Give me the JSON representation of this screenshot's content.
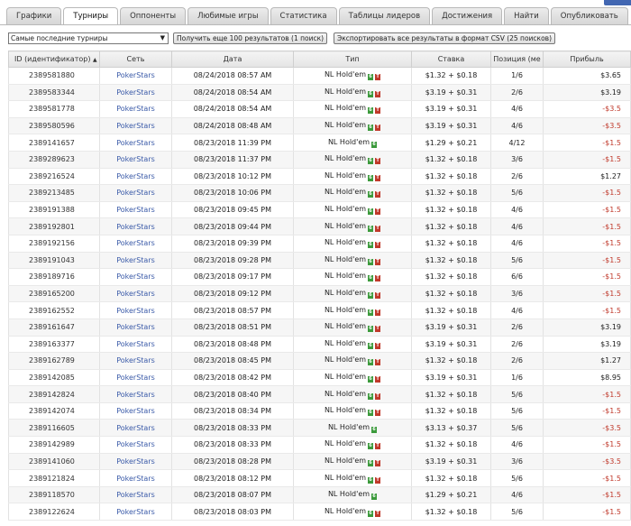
{
  "tabs": [
    {
      "label": "Графики",
      "active": false
    },
    {
      "label": "Турниры",
      "active": true
    },
    {
      "label": "Оппоненты",
      "active": false
    },
    {
      "label": "Любимые игры",
      "active": false
    },
    {
      "label": "Статистика",
      "active": false
    },
    {
      "label": "Таблицы лидеров",
      "active": false
    },
    {
      "label": "Достижения",
      "active": false
    },
    {
      "label": "Найти",
      "active": false
    },
    {
      "label": "Опубликовать",
      "active": false
    }
  ],
  "controls": {
    "filter_value": "Самые последние турниры",
    "more_button": "Получить еще 100 результатов (1 поиск)",
    "export_button": "Экспортировать все результаты в формат CSV (25 поисков)"
  },
  "table": {
    "headers": {
      "id": "ID (идентификатор)",
      "site": "Сеть",
      "date": "Дата",
      "type": "Тип",
      "stake": "Ставка",
      "position": "Позиция (ме",
      "profit": "Прибыль"
    },
    "rows": [
      {
        "id": "2389581880",
        "site": "PokerStars",
        "date": "08/24/2018 08:57 AM",
        "type": "NL Hold'em",
        "badge2": true,
        "stake": "$1.32 + $0.18",
        "position": "1/6",
        "profit": "$3.65",
        "neg": false
      },
      {
        "id": "2389583344",
        "site": "PokerStars",
        "date": "08/24/2018 08:54 AM",
        "type": "NL Hold'em",
        "badge2": true,
        "stake": "$3.19 + $0.31",
        "position": "2/6",
        "profit": "$3.19",
        "neg": false
      },
      {
        "id": "2389581778",
        "site": "PokerStars",
        "date": "08/24/2018 08:54 AM",
        "type": "NL Hold'em",
        "badge2": true,
        "stake": "$3.19 + $0.31",
        "position": "4/6",
        "profit": "-$3.5",
        "neg": true
      },
      {
        "id": "2389580596",
        "site": "PokerStars",
        "date": "08/24/2018 08:48 AM",
        "type": "NL Hold'em",
        "badge2": true,
        "stake": "$3.19 + $0.31",
        "position": "4/6",
        "profit": "-$3.5",
        "neg": true
      },
      {
        "id": "2389141657",
        "site": "PokerStars",
        "date": "08/23/2018 11:39 PM",
        "type": "NL Hold'em",
        "badge2": false,
        "stake": "$1.29 + $0.21",
        "position": "4/12",
        "profit": "-$1.5",
        "neg": true
      },
      {
        "id": "2389289623",
        "site": "PokerStars",
        "date": "08/23/2018 11:37 PM",
        "type": "NL Hold'em",
        "badge2": true,
        "stake": "$1.32 + $0.18",
        "position": "3/6",
        "profit": "-$1.5",
        "neg": true
      },
      {
        "id": "2389216524",
        "site": "PokerStars",
        "date": "08/23/2018 10:12 PM",
        "type": "NL Hold'em",
        "badge2": true,
        "stake": "$1.32 + $0.18",
        "position": "2/6",
        "profit": "$1.27",
        "neg": false
      },
      {
        "id": "2389213485",
        "site": "PokerStars",
        "date": "08/23/2018 10:06 PM",
        "type": "NL Hold'em",
        "badge2": true,
        "stake": "$1.32 + $0.18",
        "position": "5/6",
        "profit": "-$1.5",
        "neg": true
      },
      {
        "id": "2389191388",
        "site": "PokerStars",
        "date": "08/23/2018 09:45 PM",
        "type": "NL Hold'em",
        "badge2": true,
        "stake": "$1.32 + $0.18",
        "position": "4/6",
        "profit": "-$1.5",
        "neg": true
      },
      {
        "id": "2389192801",
        "site": "PokerStars",
        "date": "08/23/2018 09:44 PM",
        "type": "NL Hold'em",
        "badge2": true,
        "stake": "$1.32 + $0.18",
        "position": "4/6",
        "profit": "-$1.5",
        "neg": true
      },
      {
        "id": "2389192156",
        "site": "PokerStars",
        "date": "08/23/2018 09:39 PM",
        "type": "NL Hold'em",
        "badge2": true,
        "stake": "$1.32 + $0.18",
        "position": "4/6",
        "profit": "-$1.5",
        "neg": true
      },
      {
        "id": "2389191043",
        "site": "PokerStars",
        "date": "08/23/2018 09:28 PM",
        "type": "NL Hold'em",
        "badge2": true,
        "stake": "$1.32 + $0.18",
        "position": "5/6",
        "profit": "-$1.5",
        "neg": true
      },
      {
        "id": "2389189716",
        "site": "PokerStars",
        "date": "08/23/2018 09:17 PM",
        "type": "NL Hold'em",
        "badge2": true,
        "stake": "$1.32 + $0.18",
        "position": "6/6",
        "profit": "-$1.5",
        "neg": true
      },
      {
        "id": "2389165200",
        "site": "PokerStars",
        "date": "08/23/2018 09:12 PM",
        "type": "NL Hold'em",
        "badge2": true,
        "stake": "$1.32 + $0.18",
        "position": "3/6",
        "profit": "-$1.5",
        "neg": true
      },
      {
        "id": "2389162552",
        "site": "PokerStars",
        "date": "08/23/2018 08:57 PM",
        "type": "NL Hold'em",
        "badge2": true,
        "stake": "$1.32 + $0.18",
        "position": "4/6",
        "profit": "-$1.5",
        "neg": true
      },
      {
        "id": "2389161647",
        "site": "PokerStars",
        "date": "08/23/2018 08:51 PM",
        "type": "NL Hold'em",
        "badge2": true,
        "stake": "$3.19 + $0.31",
        "position": "2/6",
        "profit": "$3.19",
        "neg": false
      },
      {
        "id": "2389163377",
        "site": "PokerStars",
        "date": "08/23/2018 08:48 PM",
        "type": "NL Hold'em",
        "badge2": true,
        "stake": "$3.19 + $0.31",
        "position": "2/6",
        "profit": "$3.19",
        "neg": false
      },
      {
        "id": "2389162789",
        "site": "PokerStars",
        "date": "08/23/2018 08:45 PM",
        "type": "NL Hold'em",
        "badge2": true,
        "stake": "$1.32 + $0.18",
        "position": "2/6",
        "profit": "$1.27",
        "neg": false
      },
      {
        "id": "2389142085",
        "site": "PokerStars",
        "date": "08/23/2018 08:42 PM",
        "type": "NL Hold'em",
        "badge2": true,
        "stake": "$3.19 + $0.31",
        "position": "1/6",
        "profit": "$8.95",
        "neg": false
      },
      {
        "id": "2389142824",
        "site": "PokerStars",
        "date": "08/23/2018 08:40 PM",
        "type": "NL Hold'em",
        "badge2": true,
        "stake": "$1.32 + $0.18",
        "position": "5/6",
        "profit": "-$1.5",
        "neg": true
      },
      {
        "id": "2389142074",
        "site": "PokerStars",
        "date": "08/23/2018 08:34 PM",
        "type": "NL Hold'em",
        "badge2": true,
        "stake": "$1.32 + $0.18",
        "position": "5/6",
        "profit": "-$1.5",
        "neg": true
      },
      {
        "id": "2389116605",
        "site": "PokerStars",
        "date": "08/23/2018 08:33 PM",
        "type": "NL Hold'em",
        "badge2": false,
        "stake": "$3.13 + $0.37",
        "position": "5/6",
        "profit": "-$3.5",
        "neg": true
      },
      {
        "id": "2389142989",
        "site": "PokerStars",
        "date": "08/23/2018 08:33 PM",
        "type": "NL Hold'em",
        "badge2": true,
        "stake": "$1.32 + $0.18",
        "position": "4/6",
        "profit": "-$1.5",
        "neg": true
      },
      {
        "id": "2389141060",
        "site": "PokerStars",
        "date": "08/23/2018 08:28 PM",
        "type": "NL Hold'em",
        "badge2": true,
        "stake": "$3.19 + $0.31",
        "position": "3/6",
        "profit": "-$3.5",
        "neg": true
      },
      {
        "id": "2389121824",
        "site": "PokerStars",
        "date": "08/23/2018 08:12 PM",
        "type": "NL Hold'em",
        "badge2": true,
        "stake": "$1.32 + $0.18",
        "position": "5/6",
        "profit": "-$1.5",
        "neg": true
      },
      {
        "id": "2389118570",
        "site": "PokerStars",
        "date": "08/23/2018 08:07 PM",
        "type": "NL Hold'em",
        "badge2": false,
        "stake": "$1.29 + $0.21",
        "position": "4/6",
        "profit": "-$1.5",
        "neg": true
      },
      {
        "id": "2389122624",
        "site": "PokerStars",
        "date": "08/23/2018 08:03 PM",
        "type": "NL Hold'em",
        "badge2": true,
        "stake": "$1.32 + $0.18",
        "position": "5/6",
        "profit": "-$1.5",
        "neg": true
      }
    ]
  },
  "colors": {
    "negative": "#c0392b",
    "link": "#3a5aa8",
    "badge_green": "#3c9a3c",
    "badge_red": "#c0392b"
  }
}
